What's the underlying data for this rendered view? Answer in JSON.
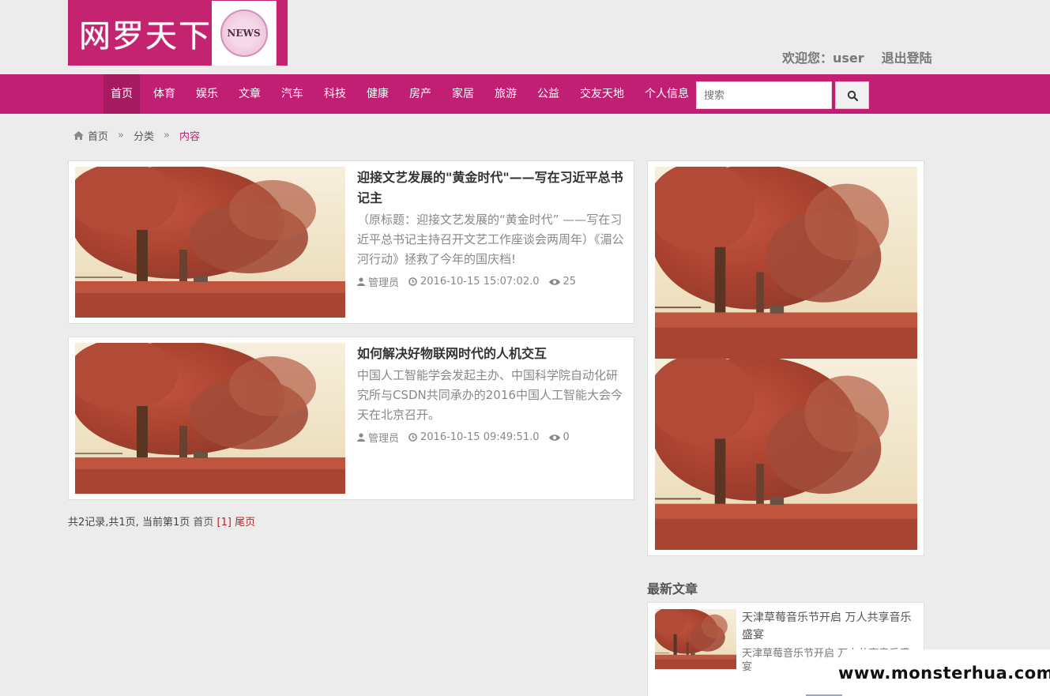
{
  "header": {
    "logo_text": "网罗天下",
    "logo_badge": "NEWS",
    "welcome_label": "欢迎您：user",
    "logout_label": "退出登陆"
  },
  "nav": {
    "items": [
      {
        "label": "首页",
        "active": true
      },
      {
        "label": "体育"
      },
      {
        "label": "娱乐"
      },
      {
        "label": "文章"
      },
      {
        "label": "汽车"
      },
      {
        "label": "科技"
      },
      {
        "label": "健康"
      },
      {
        "label": "房产"
      },
      {
        "label": "家居"
      },
      {
        "label": "旅游"
      },
      {
        "label": "公益"
      },
      {
        "label": "交友天地"
      },
      {
        "label": "个人信息"
      }
    ],
    "search_placeholder": "搜索"
  },
  "breadcrumb": {
    "home": "首页",
    "sep1": "»",
    "category": "分类",
    "sep2": "»",
    "current": "内容"
  },
  "articles": [
    {
      "title": "迎接文艺发展的\"黄金时代\"——写在习近平总书记主",
      "desc": "（原标题：迎接文艺发展的“黄金时代” ——写在习近平总书记主持召开文艺工作座谈会两周年）《湄公河行动》拯救了今年的国庆档!",
      "author": "管理员",
      "date": "2016-10-15 15:07:02.0",
      "views": "25"
    },
    {
      "title": "如何解决好物联网时代的人机交互",
      "desc": "中国人工智能学会发起主办、中国科学院自动化研究所与CSDN共同承办的2016中国人工智能大会今天在北京召开。",
      "author": "管理员",
      "date": "2016-10-15 09:49:51.0",
      "views": "0"
    }
  ],
  "pager": {
    "summary": "共2记录,共1页, 当前第1页 ",
    "first": "首页",
    "current": "[1]",
    "last": "尾页"
  },
  "sidebar": {
    "latest_title": "最新文章",
    "latest_item_title": "天津草莓音乐节开启 万人共享音乐盛宴",
    "latest_item_desc": "天津草莓音乐节开启 万人共享音乐盛宴"
  },
  "watermark": "www.monsterhua.com",
  "colors": {
    "brand": "#c11f73",
    "nav_active": "#a61a61",
    "pager_current": "#c11f1f"
  }
}
